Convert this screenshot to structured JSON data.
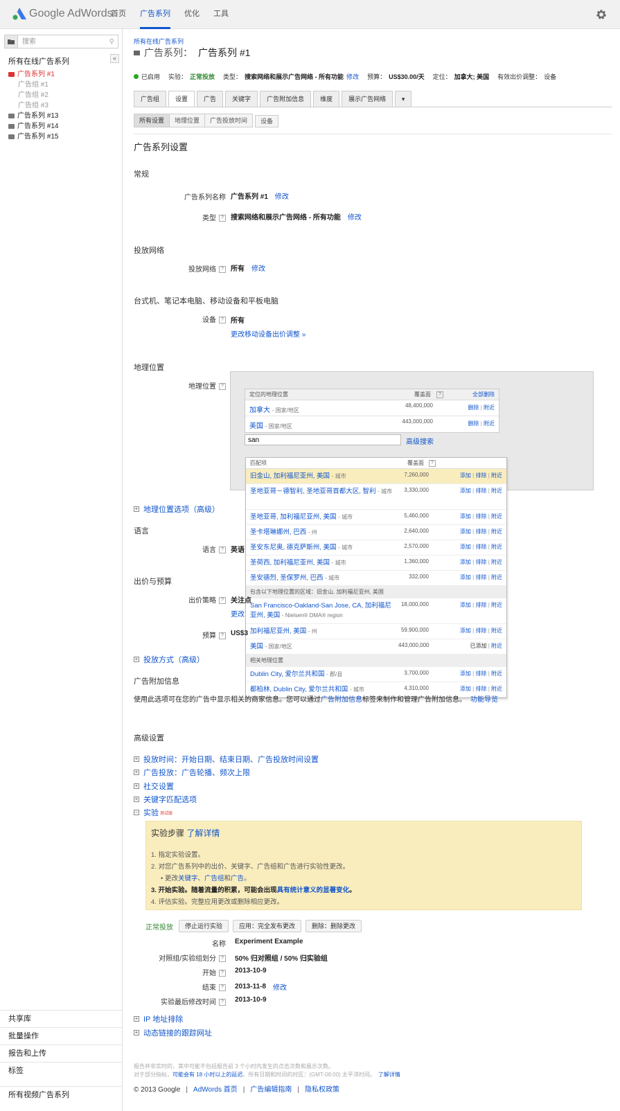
{
  "app": {
    "logo_text": "Google AdWords"
  },
  "nav": {
    "home": "首页",
    "campaigns": "广告系列",
    "optimize": "优化",
    "tools": "工具"
  },
  "sidebar": {
    "search_placeholder": "搜索",
    "title": "所有在线广告系列",
    "tree": {
      "c1": "广告系列 #1",
      "g1": "广告组 #1",
      "g2": "广告组 #2",
      "g3": "广告组 #3",
      "c13": "广告系列 #13",
      "c14": "广告系列 #14",
      "c15": "广告系列 #15"
    },
    "bottom": {
      "shared": "共享库",
      "bulk": "批量操作",
      "reports": "报告和上传",
      "labels": "标签",
      "video": "所有视频广告系列"
    }
  },
  "header": {
    "breadcrumb": "所有在线广告系列",
    "title_label": "广告系列：",
    "title": "广告系列 #1"
  },
  "status": {
    "enabled": "已启用",
    "experiment_label": "实验：",
    "experiment_value": "正常投放",
    "type_label": "类型：",
    "type_value": "搜索网络和展示广告网络 - 所有功能",
    "edit": "修改",
    "budget_label": "预算：",
    "budget_value": "US$30.00/天",
    "targeting_label": "定位：",
    "targeting_value": "加拿大; 美国",
    "bid_adj_label": "有效出价调整：",
    "bid_adj_value": "设备"
  },
  "tabs": {
    "adgroups": "广告组",
    "settings": "设置",
    "ads": "广告",
    "keywords": "关键字",
    "extensions": "广告附加信息",
    "dimensions": "维度",
    "display": "展示广告网络"
  },
  "subtabs": {
    "all": "所有设置",
    "locations": "地理位置",
    "schedule": "广告投放时间",
    "devices": "设备"
  },
  "settings": {
    "heading": "广告系列设置",
    "general": "常规",
    "name_label": "广告系列名称",
    "name_value": "广告系列 #1",
    "edit": "修改",
    "type_label": "类型",
    "type_value": "搜索网络和展示广告网络 - 所有功能",
    "networks_heading": "投放网络",
    "networks_label": "投放网络",
    "networks_value": "所有",
    "devices_heading": "台式机、笔记本电脑、移动设备和平板电脑",
    "devices_label": "设备",
    "devices_value": "所有",
    "devices_link": "更改移动设备出价调整 »",
    "locations_heading": "地理位置",
    "locations_label": "地理位置",
    "location_options": "地理位置选项（高级）",
    "language_heading": "语言",
    "language_label": "语言",
    "language_value": "英语",
    "bidding_heading": "出价与预算",
    "bid_strategy_label": "出价策略",
    "bid_strategy_value": "关注点",
    "bid_strategy_link": "更改",
    "budget_label": "预算",
    "budget_value": "US$3",
    "delivery": "投放方式（高级）",
    "extensions_heading": "广告附加信息",
    "extensions_text_1": "使用此选项可在您的广告中显示相关的商家信息。您可以通过",
    "extensions_link": "广告附加信息",
    "extensions_text_2": "标签来制作和管理广告附加信息。",
    "extensions_guide": "功能导览",
    "advanced_heading": "高级设置",
    "adv_schedule": "投放时间：开始日期、结束日期、广告投放时间设置",
    "adv_delivery": "广告投放：广告轮播、频次上限",
    "adv_social": "社交设置",
    "adv_keyword": "关键字匹配选项",
    "adv_experiment": "实验",
    "adv_experiment_badge": "测试版",
    "ip_exclusion": "IP 地址排除",
    "tracking": "动态链接的跟踪网址"
  },
  "geo": {
    "col_location": "定位的地理位置",
    "col_reach": "覆盖面",
    "remove_all": "全部删除",
    "rows": [
      {
        "name": "加拿大",
        "type": "- 国家/地区",
        "reach": "48,400,000"
      },
      {
        "name": "美国",
        "type": "- 国家/地区",
        "reach": "443,000,000"
      }
    ],
    "row_remove": "删除",
    "row_nearby": "附近",
    "input_value": "san",
    "advanced_search": "高级搜索"
  },
  "dropdown": {
    "col_matches": "匹配项",
    "col_reach": "覆盖面",
    "add": "添加",
    "exclude": "排除",
    "nearby": "附近",
    "added": "已添加",
    "matches": [
      {
        "name": "旧金山, 加利福尼亚州, 美国",
        "type": "- 城市",
        "reach": "7,260,000"
      },
      {
        "name": "圣地亚哥－德智利, 圣地亚哥首都大区, 智利",
        "type": "- 城市",
        "reach": "3,330,000"
      },
      {
        "name": "圣地亚哥, 加利福尼亚州, 美国",
        "type": "- 城市",
        "reach": "5,460,000"
      },
      {
        "name": "圣卡塔琳娜州, 巴西",
        "type": "- 州",
        "reach": "2,640,000"
      },
      {
        "name": "圣安东尼奥, 德克萨斯州, 美国",
        "type": "- 城市",
        "reach": "2,570,000"
      },
      {
        "name": "圣荷西, 加利福尼亚州, 美国",
        "type": "- 城市",
        "reach": "1,360,000"
      },
      {
        "name": "圣安德烈, 圣保罗州, 巴西",
        "type": "- 城市",
        "reach": "332,000"
      }
    ],
    "contains_heading": "包含以下地理位置的区域：旧金山, 加利福尼亚州, 美国",
    "contains": [
      {
        "name": "San Francisco-Oakland-San Jose, CA, 加利福尼亚州, 美国",
        "type": "- Nielsen® DMA® region",
        "reach": "18,000,000"
      },
      {
        "name": "加利福尼亚州, 美国",
        "type": "- 州",
        "reach": "59,900,000"
      },
      {
        "name": "美国",
        "type": "- 国家/地区",
        "reach": "443,000,000"
      }
    ],
    "related_heading": "相关地理位置",
    "related": [
      {
        "name": "Dublin City, 爱尔兰共和国",
        "type": "- 郡/县",
        "reach": "3,700,000"
      },
      {
        "name": "都柏林, Dublin City, 爱尔兰共和国",
        "type": "- 城市",
        "reach": "4,310,000"
      }
    ]
  },
  "experiment": {
    "steps_title": "实验步骤",
    "learn_more": "了解详情",
    "step1": "1. 指定实验设置。",
    "step2": "2. 对您广告系列中的出价、关键字、广告组和广告进行实验性更改。",
    "step2_sub_1": "更改",
    "step2_sub_kw": "关键字",
    "step2_sub_sep1": "、",
    "step2_sub_ag": "广告组",
    "step2_sub_and": "和",
    "step2_sub_ads": "广告",
    "step2_sub_end": "。",
    "step3_a": "3. 开始实验。随着流量的积累，可能会出现",
    "step3_link": "具有统计意义的显著变化",
    "step3_b": "。",
    "step4": "4. 评估实验。完整应用更改或删除相应更改。",
    "status": "正常投放",
    "stop_btn": "停止运行实验",
    "apply_btn": "应用：完全发布更改",
    "delete_btn": "删除：删除更改",
    "name_label": "名称",
    "name_value": "Experiment Example",
    "split_label": "对照组/实验组划分",
    "split_value": "50% 归对照组 / 50% 归实验组",
    "start_label": "开始",
    "start_value": "2013-10-9",
    "end_label": "结束",
    "end_value": "2013-11-8",
    "edit": "修改",
    "modified_label": "实验最后修改时间",
    "modified_value": "2013-10-9"
  },
  "footer": {
    "note1": "报告并非实时的，其中可能不包括报告前 3 个小时内发生的点击次数和展示次数。",
    "note2_a": "对于部分指标，",
    "note2_link": "可能会有 18 小时以上的延迟",
    "note2_b": "。所有日期和时间的时区：(GMT-08:00) 太平洋时间。",
    "note2_learn": "了解详情",
    "copyright": "© 2013 Google",
    "home": "AdWords 首页",
    "guide": "广告编辑指南",
    "privacy": "隐私权政策",
    "sep": "|"
  }
}
